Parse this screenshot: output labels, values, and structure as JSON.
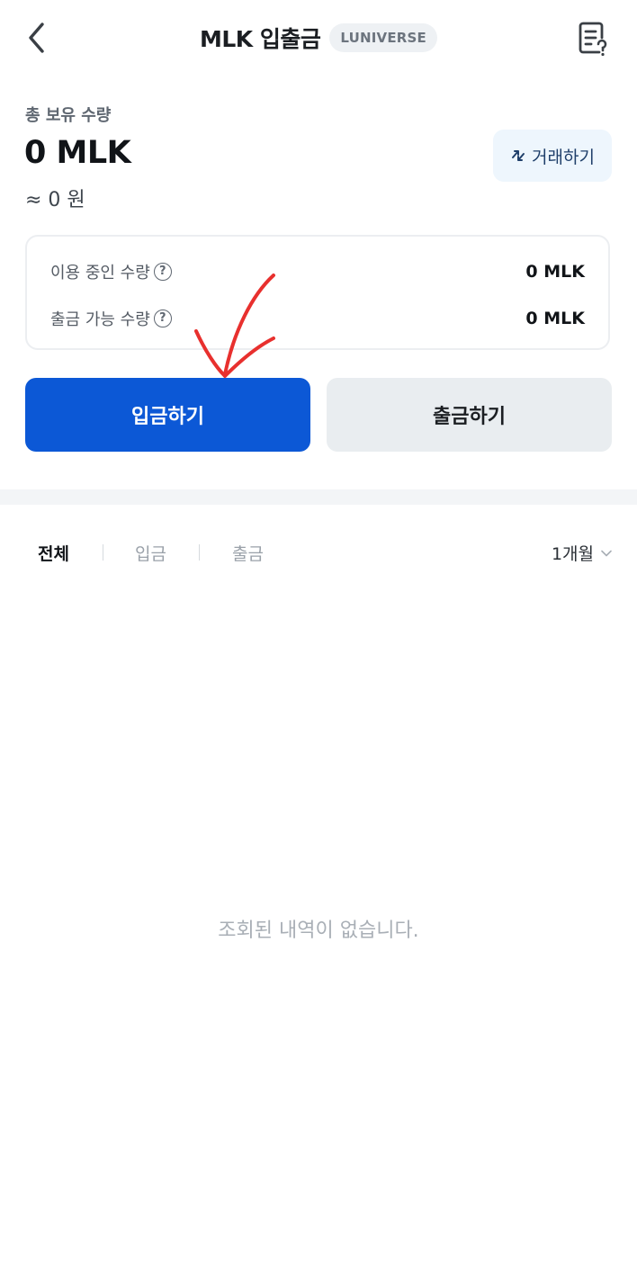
{
  "header": {
    "title": "MLK 입출금",
    "badge": "LUNIVERSE",
    "back_icon": "chevron-left-icon",
    "history_icon": "document-question-icon"
  },
  "balance": {
    "label": "총 보유 수량",
    "amount": "0 MLK",
    "krw": "≈ 0 원",
    "trade_button": "거래하기",
    "trade_icon": "swap-arrows-icon"
  },
  "details": [
    {
      "label": "이용 중인 수량",
      "value": "0 MLK",
      "help": "?"
    },
    {
      "label": "출금 가능 수량",
      "value": "0 MLK",
      "help": "?"
    }
  ],
  "actions": {
    "deposit": "입금하기",
    "withdraw": "출금하기"
  },
  "filters": {
    "tabs": [
      "전체",
      "입금",
      "출금"
    ],
    "active_tab": "전체",
    "period": "1개월",
    "period_icon": "chevron-down-icon"
  },
  "empty_state": "조회된 내역이 없습니다.",
  "colors": {
    "primary": "#0c58d6",
    "secondary_button": "#e9edf0",
    "trade_button_bg": "#eef6fd",
    "annotation": "#e8302e"
  }
}
